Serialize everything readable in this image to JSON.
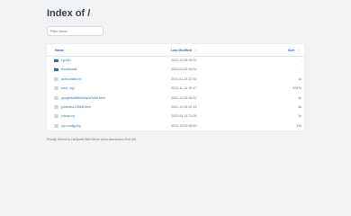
{
  "page": {
    "title": "Index of /"
  },
  "filter": {
    "placeholder": "Filter Name"
  },
  "table": {
    "headers": {
      "name": "Name",
      "modified": "Last Modified",
      "size": "Size"
    },
    "sort_arrow": "↑",
    "sort_arrow_inactive": "↕",
    "rows": [
      {
        "type": "folder",
        "name": "cgi-bin",
        "modified": "2022-12-06 08:20",
        "size": "-"
      },
      {
        "type": "folder",
        "name": "thumbnails",
        "modified": "2023-01-05 04:00",
        "size": "-"
      },
      {
        "type": "file",
        "name": "achocolate.txt",
        "modified": "2021-01-24 22:34",
        "size": "1k"
      },
      {
        "type": "file",
        "name": "error_log",
        "modified": "2024-11-14 19:17",
        "size": "4087k"
      },
      {
        "type": "file",
        "name": "google6a9f6d2b9a3f7ebd.html",
        "modified": "2021-12-06 08:20",
        "size": "1k"
      },
      {
        "type": "file",
        "name": "pinterest-235e8.html",
        "modified": "2021-12-06 02:14",
        "size": "5k"
      },
      {
        "type": "file",
        "name": "robots.txt",
        "modified": "2023-05-14 23:05",
        "size": "1k"
      },
      {
        "type": "file",
        "name": "wp-config.php",
        "modified": "2024-10-09 08:59",
        "size": "13k"
      }
    ]
  },
  "footer": {
    "text": "Proudly Served by LiteSpeed Web Server at fon-download.ru Port 443"
  },
  "colors": {
    "link": "#2e6fb3",
    "folder": "#2e6fb3",
    "file": "#7a8592"
  }
}
